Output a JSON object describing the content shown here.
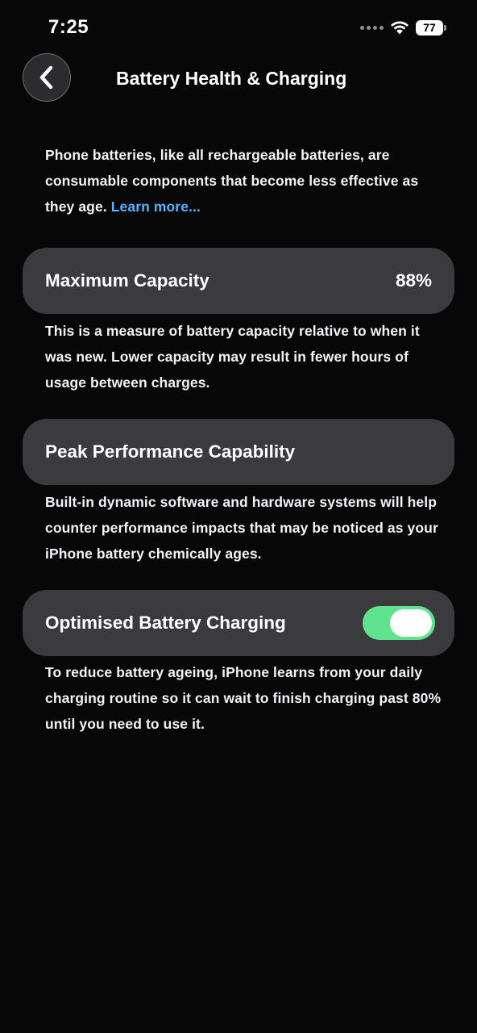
{
  "status_bar": {
    "time": "7:25",
    "battery_level": "77",
    "icons": [
      "signal-dots-icon",
      "wifi-icon",
      "battery-icon"
    ]
  },
  "nav": {
    "title": "Battery Health & Charging",
    "back_icon": "chevron-left-icon"
  },
  "intro": {
    "text": "Phone batteries, like all rechargeable batteries, are consumable components that become less effective as they age. ",
    "link": "Learn more..."
  },
  "max_capacity": {
    "label": "Maximum Capacity",
    "value": "88%",
    "description": "This is a measure of battery capacity relative to when it was new. Lower capacity may result in fewer hours of usage between charges."
  },
  "peak_performance": {
    "label": "Peak Performance Capability",
    "description": "Built-in dynamic software and hardware systems will help counter performance impacts that may be noticed as your iPhone battery chemically ages."
  },
  "optimised_charging": {
    "label": "Optimised Battery Charging",
    "enabled": true,
    "description": "To reduce battery ageing, iPhone learns from your daily charging routine so it can wait to finish charging past 80% until you need to use it."
  },
  "colors": {
    "background": "#070708",
    "card": "#3a3a3f",
    "link": "#5ab3ff",
    "toggle_on": "#5fe38f"
  }
}
